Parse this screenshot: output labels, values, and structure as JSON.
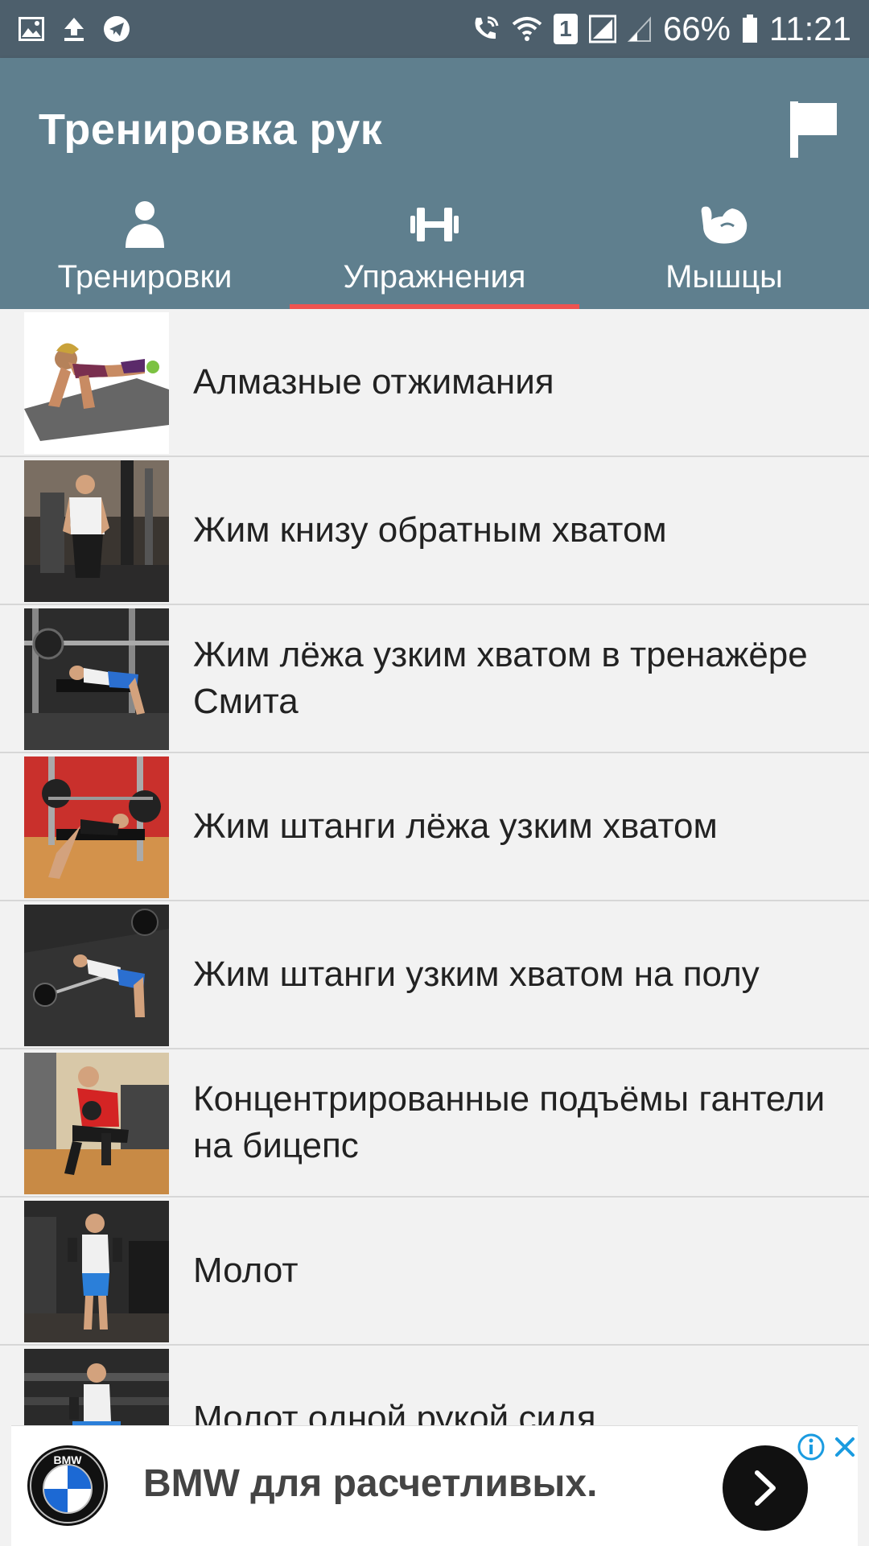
{
  "status_bar": {
    "battery": "66%",
    "time": "11:21",
    "sim": "1",
    "left_icons": [
      "image-icon",
      "upload-icon",
      "telegram-icon"
    ],
    "right_icons": [
      "wifi-call-icon",
      "wifi-icon",
      "sim-icon",
      "signal-icon",
      "signal-weak-icon",
      "battery-icon"
    ]
  },
  "app_bar": {
    "title": "Тренировка рук",
    "action_icon": "flag-icon"
  },
  "tabs": [
    {
      "label": "Тренировки",
      "icon": "person-icon",
      "selected": false
    },
    {
      "label": "Упражнения",
      "icon": "dumbbell-icon",
      "selected": true
    },
    {
      "label": "Мышцы",
      "icon": "bicep-icon",
      "selected": false
    }
  ],
  "exercises": [
    {
      "label": "Алмазные отжимания"
    },
    {
      "label": "Жим книзу обратным хватом"
    },
    {
      "label": "Жим лёжа узким хватом в тренажёре Смита"
    },
    {
      "label": "Жим штанги лёжа узким хватом"
    },
    {
      "label": "Жим штанги узким хватом на полу"
    },
    {
      "label": "Концентрированные подъёмы гантели на бицепс"
    },
    {
      "label": "Молот"
    },
    {
      "label": "Молот одной рукой сидя"
    }
  ],
  "ad": {
    "text": "BMW для расчетливых.",
    "logo": "bmw-logo",
    "logo_letters": "BMW"
  },
  "colors": {
    "status_bar": "#4d5f6c",
    "app_bar": "#5f7f8e",
    "tab_indicator": "#ef5350",
    "ad_info": "#1a9be0"
  }
}
